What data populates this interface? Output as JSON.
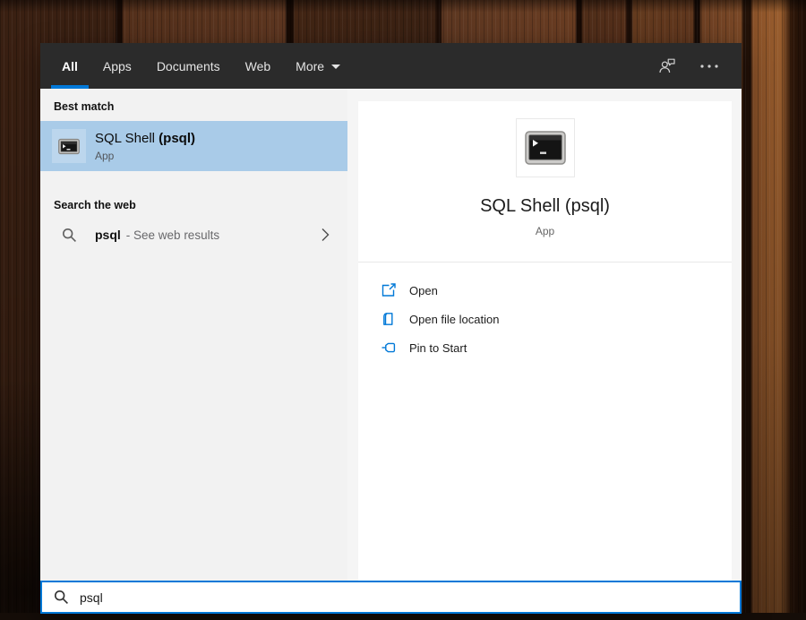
{
  "header": {
    "tabs": [
      {
        "label": "All",
        "active": true
      },
      {
        "label": "Apps",
        "active": false
      },
      {
        "label": "Documents",
        "active": false
      },
      {
        "label": "Web",
        "active": false
      },
      {
        "label": "More",
        "active": false,
        "caret": "chevron-down-icon"
      }
    ],
    "icons": [
      {
        "name": "feedback-icon"
      },
      {
        "name": "ellipsis-icon"
      }
    ]
  },
  "results": {
    "best_match": {
      "heading": "Best match",
      "item": {
        "icon": "terminal-icon",
        "title": "SQL Shell ",
        "title_match": "(psql)",
        "type": "App"
      }
    },
    "web": {
      "heading": "Search the web",
      "item": {
        "icon": "search-icon",
        "query": "psql",
        "suffix": "- See web results",
        "chevron": "chevron-right-icon"
      }
    }
  },
  "detail": {
    "icon": "terminal-icon",
    "title": "SQL Shell (psql)",
    "subtitle": "App",
    "actions": [
      {
        "icon": "open-icon",
        "label": "Open"
      },
      {
        "icon": "folder-icon",
        "label": "Open file location"
      },
      {
        "icon": "pin-icon",
        "label": "Pin to Start"
      }
    ]
  },
  "search_bar": {
    "icon": "search-icon",
    "value": "psql"
  },
  "colors": {
    "accent": "#0078d7",
    "selection": "#a9cbe8",
    "header_bg": "#2b2b2b"
  }
}
